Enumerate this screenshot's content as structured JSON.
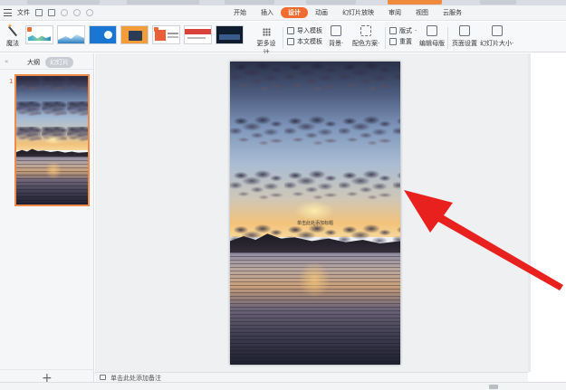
{
  "menubar": {
    "file_label": "文件",
    "tabs": [
      "开始",
      "插入",
      "设计",
      "动画",
      "幻灯片放映",
      "审阅",
      "视图",
      "云服务"
    ],
    "active_tab": "设计"
  },
  "ribbon": {
    "magic_label": "魔法",
    "more_design_label": "更多设计",
    "import_template_label": "导入模板",
    "text_template_label": "本文模板",
    "background_label": "背景",
    "color_scheme_label": "配色方案",
    "layout_label": "版式",
    "reset_label": "重置",
    "edit_master_label": "编辑母版",
    "page_setup_label": "页面设置",
    "slide_size_label": "幻灯片大小"
  },
  "outline_panel": {
    "collapse_icon": "«",
    "tab_outline": "大纲",
    "tab_slides": "幻灯片",
    "slide_number": "1",
    "add_icon": "+"
  },
  "slide": {
    "title_placeholder": "单击此处添加标题"
  },
  "notes": {
    "placeholder": "单击此处添加备注"
  },
  "colors": {
    "accent": "#f26b2f",
    "arrow": "#e8201e"
  }
}
